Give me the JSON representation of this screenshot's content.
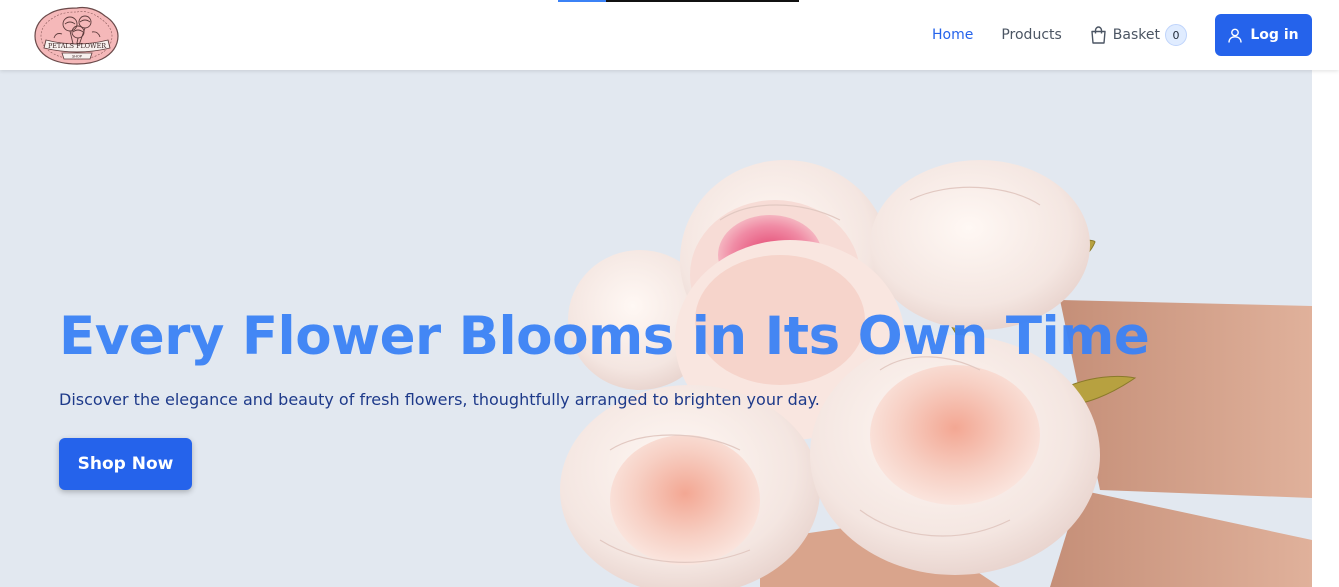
{
  "brand": {
    "logo_line1": "PETALS FLOWER",
    "logo_line2": "SHOP",
    "icon": "peony-bouquet-logo"
  },
  "progress": {
    "percent": 20
  },
  "nav": {
    "items": [
      {
        "label": "Home",
        "active": true
      },
      {
        "label": "Products",
        "active": false
      }
    ],
    "basket": {
      "label": "Basket",
      "count": "0",
      "icon": "shopping-bag-icon"
    },
    "login": {
      "label": "Log in",
      "icon": "user-icon"
    }
  },
  "hero": {
    "title": "Every Flower Blooms in Its Own Time",
    "subtitle": "Discover the elegance and beauty of fresh flowers, thoughtfully arranged to brighten your day.",
    "cta_label": "Shop Now",
    "image": "peony-bouquet-in-hands"
  },
  "colors": {
    "accent": "#2563eb",
    "title": "#3b82f6",
    "hero_bg": "#e2e8f0",
    "subtitle": "#1e3a8a"
  }
}
